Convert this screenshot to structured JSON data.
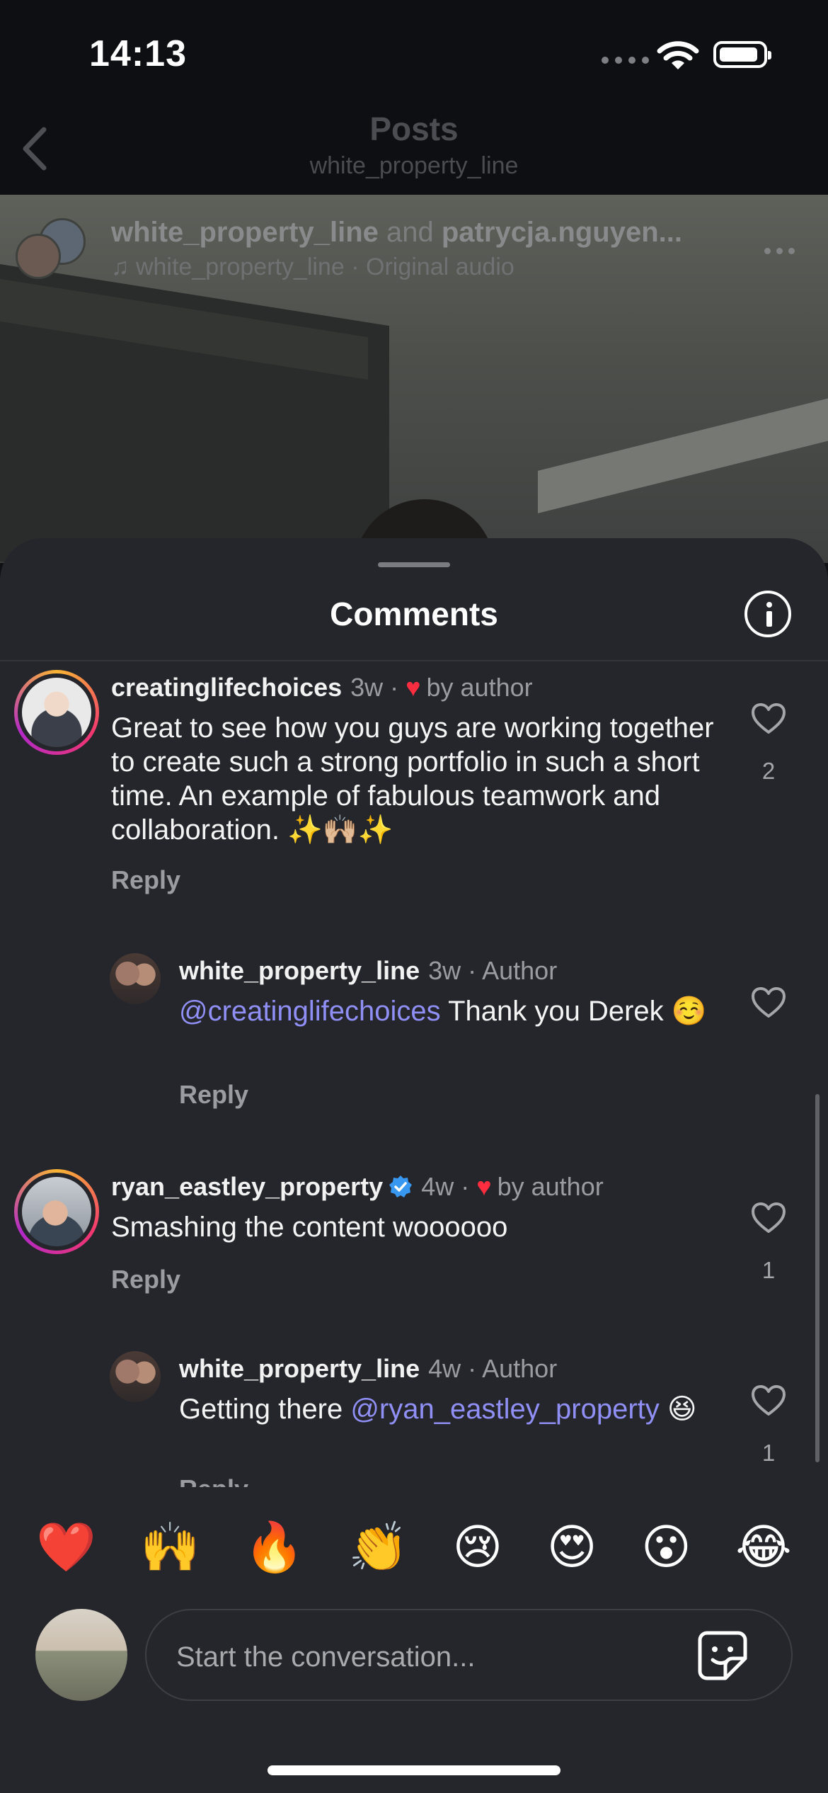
{
  "status_bar": {
    "time": "14:13"
  },
  "header": {
    "title": "Posts",
    "subtitle": "white_property_line"
  },
  "post": {
    "author_line_user1": "white_property_line",
    "author_line_and": "and",
    "author_line_user2": "patrycja.nguyen...",
    "audio": "white_property_line · Original audio"
  },
  "sheet": {
    "title": "Comments"
  },
  "comments": [
    {
      "user": "creatinglifechoices",
      "time": "3w ·",
      "liked_by_author": "by author",
      "text": "Great to see how you guys are working together to create such a strong portfolio in such a short time. An example of fabulous teamwork and collaboration. ✨🙌🏼✨",
      "reply": "Reply",
      "likes": "2"
    },
    {
      "user": "white_property_line",
      "time": "3w · Author",
      "mention": "@creatinglifechoices",
      "text": " Thank you Derek ☺️",
      "reply": "Reply"
    },
    {
      "user": "ryan_eastley_property",
      "time": "4w ·",
      "liked_by_author": "by author",
      "text": "Smashing the content woooooo",
      "reply": "Reply",
      "likes": "1"
    },
    {
      "user": "white_property_line",
      "time": "4w · Author",
      "text_prefix": "Getting there ",
      "mention": "@ryan_eastley_property",
      "text_suffix": " 😆",
      "reply": "Reply",
      "likes": "1"
    }
  ],
  "reactions": [
    "❤️",
    "🙌",
    "🔥",
    "👏",
    "😢",
    "😍",
    "😮",
    "😂"
  ],
  "composer": {
    "placeholder": "Start the conversation..."
  },
  "colors": {
    "sheet_bg": "#25262b",
    "mention": "#8f8ff5",
    "like_red": "#ff2d40"
  }
}
